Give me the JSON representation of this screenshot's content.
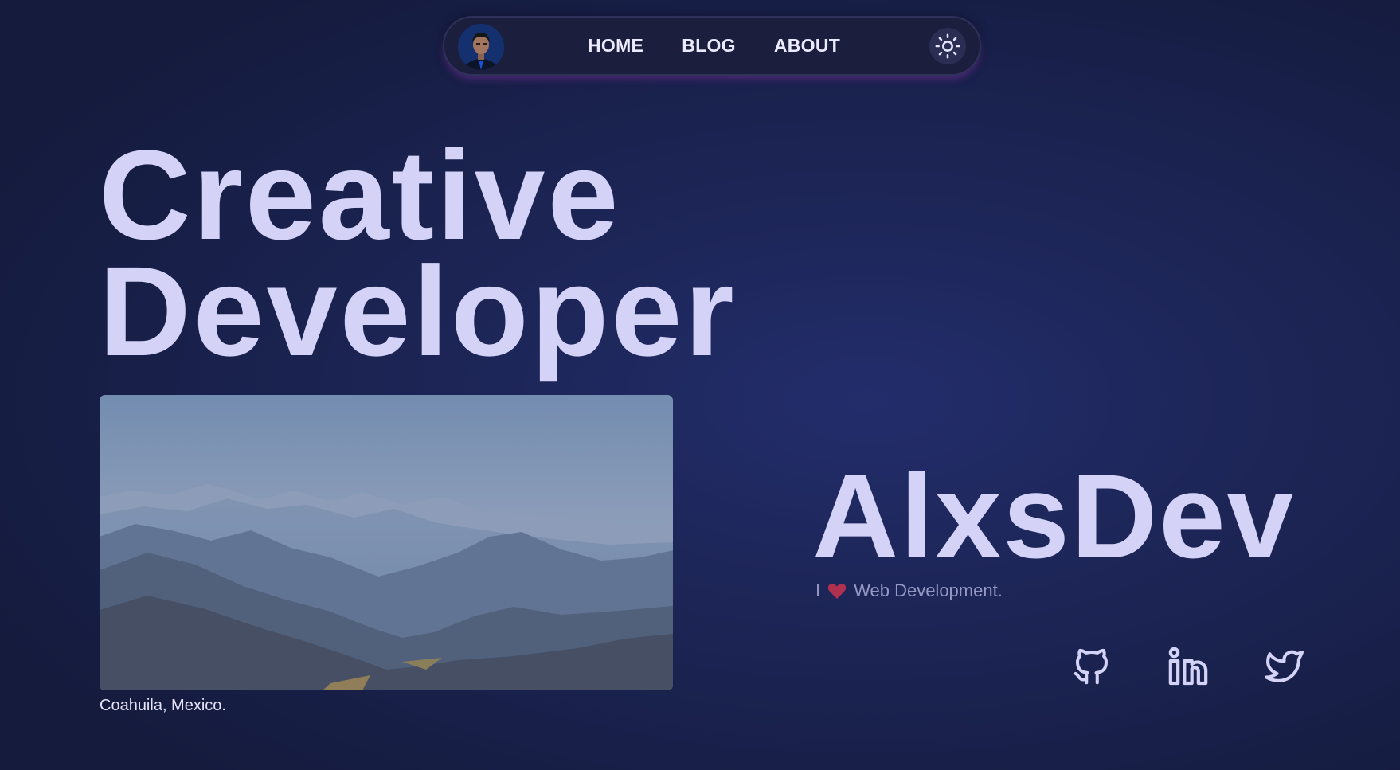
{
  "nav": {
    "links": [
      {
        "label": "HOME"
      },
      {
        "label": "BLOG"
      },
      {
        "label": "ABOUT"
      }
    ],
    "theme_icon": "sun-icon"
  },
  "hero": {
    "line1": "Creative",
    "line2": "Developer"
  },
  "photo": {
    "caption": "Coahuila, Mexico."
  },
  "brand": {
    "name": "AlxsDev",
    "tagline_prefix": "I",
    "tagline_icon": "heart-icon",
    "tagline_suffix": "Web Development."
  },
  "socials": [
    {
      "icon": "github-icon"
    },
    {
      "icon": "linkedin-icon"
    },
    {
      "icon": "twitter-icon"
    }
  ],
  "colors": {
    "background": "#1d2658",
    "text": "#d4d3f7",
    "nav_bg": "#1b1e3c",
    "nav_glow": "#9b3cc8",
    "heart": "#b0304f"
  }
}
